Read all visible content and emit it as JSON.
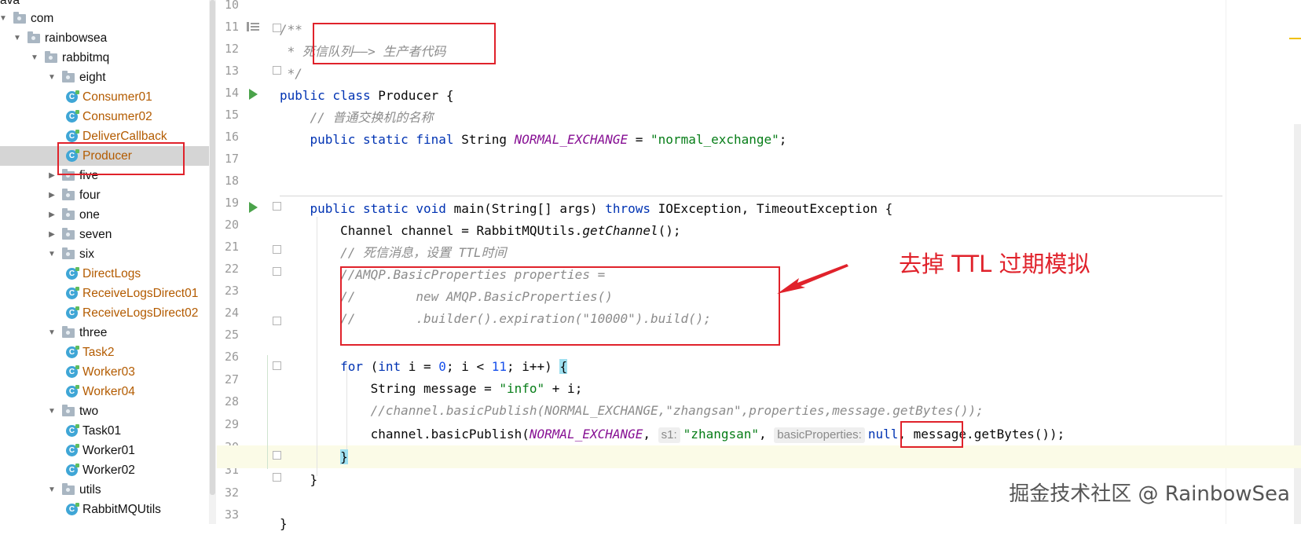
{
  "tree": {
    "top_partial": "ava",
    "items": [
      {
        "label": "com",
        "kind": "folder",
        "depth": 0,
        "expanded": true
      },
      {
        "label": "rainbowsea",
        "kind": "folder",
        "depth": 1,
        "expanded": true
      },
      {
        "label": "rabbitmq",
        "kind": "folder",
        "depth": 2,
        "expanded": true
      },
      {
        "label": "eight",
        "kind": "folder",
        "depth": 3,
        "expanded": true
      },
      {
        "label": "Consumer01",
        "kind": "class",
        "depth": 4
      },
      {
        "label": "Consumer02",
        "kind": "class",
        "depth": 4
      },
      {
        "label": "DeliverCallback",
        "kind": "class",
        "depth": 4
      },
      {
        "label": "Producer",
        "kind": "class",
        "depth": 4,
        "selected": true
      },
      {
        "label": "five",
        "kind": "folder",
        "depth": 3,
        "expanded": false
      },
      {
        "label": "four",
        "kind": "folder",
        "depth": 3,
        "expanded": false
      },
      {
        "label": "one",
        "kind": "folder",
        "depth": 3,
        "expanded": false
      },
      {
        "label": "seven",
        "kind": "folder",
        "depth": 3,
        "expanded": false
      },
      {
        "label": "six",
        "kind": "folder",
        "depth": 3,
        "expanded": true
      },
      {
        "label": "DirectLogs",
        "kind": "class",
        "depth": 4
      },
      {
        "label": "ReceiveLogsDirect01",
        "kind": "class",
        "depth": 4
      },
      {
        "label": "ReceiveLogsDirect02",
        "kind": "class",
        "depth": 4
      },
      {
        "label": "three",
        "kind": "folder",
        "depth": 3,
        "expanded": true
      },
      {
        "label": "Task2",
        "kind": "class",
        "depth": 4
      },
      {
        "label": "Worker03",
        "kind": "class",
        "depth": 4
      },
      {
        "label": "Worker04",
        "kind": "class",
        "depth": 4
      },
      {
        "label": "two",
        "kind": "folder",
        "depth": 3,
        "expanded": true
      },
      {
        "label": "Task01",
        "kind": "class-plain",
        "depth": 4
      },
      {
        "label": "Worker01",
        "kind": "class-plain",
        "depth": 4
      },
      {
        "label": "Worker02",
        "kind": "class-plain",
        "depth": 4
      },
      {
        "label": "utils",
        "kind": "folder",
        "depth": 3,
        "expanded": true
      },
      {
        "label": "RabbitMQUtils",
        "kind": "class-plain",
        "depth": 4
      }
    ]
  },
  "editor": {
    "line_numbers": [
      "10",
      "11",
      "12",
      "13",
      "14",
      "15",
      "16",
      "17",
      "18",
      "19",
      "20",
      "21",
      "22",
      "23",
      "24",
      "25",
      "26",
      "27",
      "28",
      "29",
      "30",
      "31",
      "32",
      "33"
    ],
    "lines": {
      "l11": "/**",
      "l12": " * 死信队列——> 生产者代码",
      "l13": " */",
      "l14_kw": "public class ",
      "l14_name": "Producer {",
      "l15": "    // 普通交换机的名称",
      "l16_kw": "    public static final ",
      "l16_type": "String ",
      "l16_const": "NORMAL_EXCHANGE",
      "l16_eq": " = ",
      "l16_str": "\"normal_exchange\"",
      "l16_end": ";",
      "l19_kw1": "    public static void ",
      "l19_a": "main(String[] args) ",
      "l19_kw2": "throws ",
      "l19_b": "IOException, TimeoutException {",
      "l20_a": "        Channel channel = RabbitMQUtils.",
      "l20_m": "getChannel",
      "l20_b": "();",
      "l21": "        // 死信消息，设置 TTL时间",
      "l22": "        //AMQP.BasicProperties properties =",
      "l23": "        //        new AMQP.BasicProperties()",
      "l24": "        //        .builder().expiration(\"10000\").build();",
      "l26_kw": "        for ",
      "l26_a": "(",
      "l26_kw2": "int ",
      "l26_b": "i = ",
      "l26_n0": "0",
      "l26_c": "; i < ",
      "l26_n11": "11",
      "l26_d": "; i++) ",
      "l26_brace": "{",
      "l27_a": "            String message = ",
      "l27_str": "\"info\"",
      "l27_b": " + i;",
      "l28": "            //channel.basicPublish(NORMAL_EXCHANGE,\"zhangsan\",properties,message.getBytes());",
      "l29_a": "            channel.basicPublish(",
      "l29_const": "NORMAL_EXCHANGE",
      "l29_b": ", ",
      "l29_hint1": "s1:",
      "l29_str": "\"zhangsan\"",
      "l29_c": ", ",
      "l29_hint2": "basicProperties:",
      "l29_null": "null",
      "l29_d": ", message.getBytes());",
      "l30_indent": "        ",
      "l30_brace": "}",
      "l31": "    }",
      "l33": "}"
    }
  },
  "annotation": "去掉 TTL 过期模拟",
  "watermark": "掘金技术社区 @ RainbowSea",
  "colors": {
    "accent_red": "#e0222b",
    "keyword": "#0033b3",
    "string": "#067d17",
    "constant": "#871094",
    "comment": "#8c8c8c"
  }
}
